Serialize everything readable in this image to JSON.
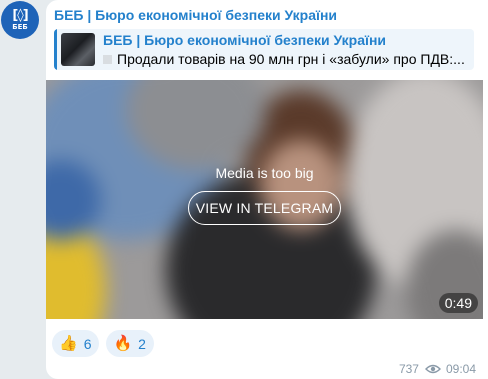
{
  "channel": {
    "name": "БЕБ | Бюро економічної безпеки України",
    "avatar_glyph": "[◊]",
    "avatar_text": "БЕБ",
    "avatar_color": "#1e63b8"
  },
  "reply": {
    "title": "БЕБ | Бюро економічної безпеки України",
    "text": "Продали товарів на 90 млн грн і «забули» про ПДВ:..."
  },
  "media": {
    "notice": "Media is too big",
    "button_label": "VIEW IN TELEGRAM",
    "duration": "0:49"
  },
  "reactions": [
    {
      "emoji": "👍",
      "count": "6"
    },
    {
      "emoji": "🔥",
      "count": "2"
    }
  ],
  "meta": {
    "views": "737",
    "time": "09:04"
  },
  "colors": {
    "accent": "#2481cc",
    "background": "#e6ebee"
  }
}
